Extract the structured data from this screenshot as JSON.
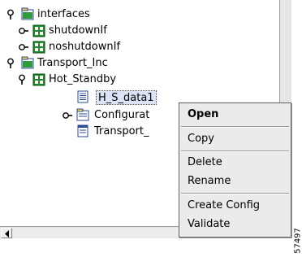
{
  "tree": {
    "nodes": [
      {
        "label": "interfaces",
        "icon": "folder-icon",
        "toggle": "expanded"
      },
      {
        "label": "shutdownIf",
        "icon": "config-object-icon",
        "toggle": "collapsed"
      },
      {
        "label": "noshutdownIf",
        "icon": "config-object-icon",
        "toggle": "collapsed"
      },
      {
        "label": "Transport_Inc",
        "icon": "folder-icon",
        "toggle": "expanded"
      },
      {
        "label": "Hot_Standby",
        "icon": "config-object-icon",
        "toggle": "expanded"
      },
      {
        "label": "H_S_data1",
        "icon": "document-icon",
        "toggle": "none",
        "selected": true
      },
      {
        "label": "Configurat",
        "icon": "folder-icon",
        "toggle": "collapsed"
      },
      {
        "label": "Transport_",
        "icon": "document-icon",
        "toggle": "none"
      }
    ]
  },
  "context_menu": {
    "items": [
      {
        "label": "Open",
        "default": true
      },
      {
        "label": "Copy"
      },
      {
        "label": "Delete"
      },
      {
        "label": "Rename"
      },
      {
        "label": "Create Config"
      },
      {
        "label": "Validate"
      }
    ]
  },
  "figure_id": "57497"
}
